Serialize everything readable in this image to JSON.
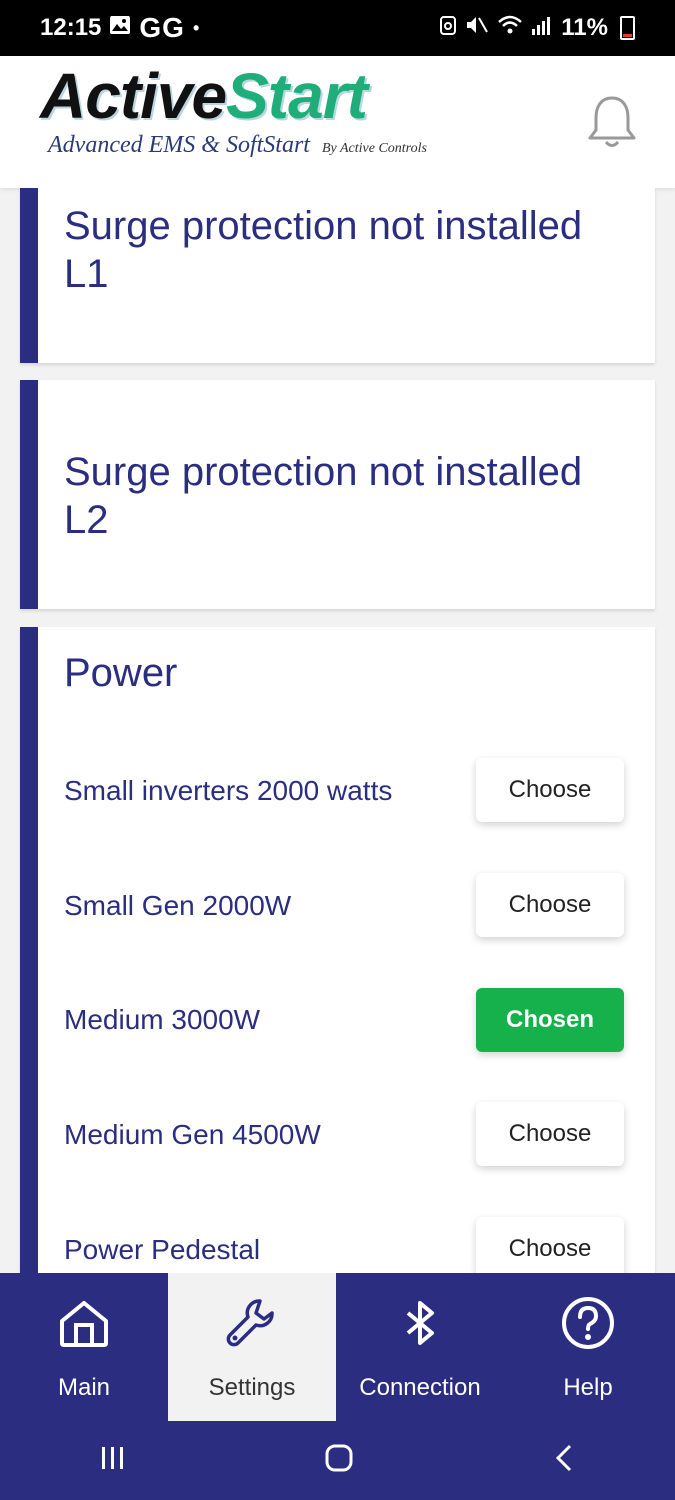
{
  "status_bar": {
    "time": "12:15",
    "carrier_badges": "GG",
    "dot": "•",
    "battery_percent": "11%"
  },
  "header": {
    "logo_active": "Active",
    "logo_start": "Start",
    "logo_subtitle": "Advanced EMS & SoftStart",
    "logo_by": "By Active Controls",
    "bell_icon": "bell-icon"
  },
  "cards": {
    "surge_l1": {
      "title_line1": "Surge protection not installed",
      "title_line2": "L1"
    },
    "surge_l2": {
      "title_line1": "Surge protection not installed",
      "title_line2": "L2"
    },
    "power": {
      "title": "Power",
      "options": [
        {
          "label": "Small inverters 2000 watts",
          "button": "Choose",
          "chosen": false
        },
        {
          "label": "Small Gen 2000W",
          "button": "Choose",
          "chosen": false
        },
        {
          "label": "Medium 3000W",
          "button": "Chosen",
          "chosen": true
        },
        {
          "label": "Medium Gen 4500W",
          "button": "Choose",
          "chosen": false
        },
        {
          "label": "Power Pedestal",
          "button": "Choose",
          "chosen": false
        }
      ]
    }
  },
  "bottom_nav": {
    "items": [
      {
        "label": "Main",
        "icon": "home-icon",
        "active": false
      },
      {
        "label": "Settings",
        "icon": "wrench-icon",
        "active": true
      },
      {
        "label": "Connection",
        "icon": "bluetooth-icon",
        "active": false
      },
      {
        "label": "Help",
        "icon": "help-icon",
        "active": false
      }
    ]
  },
  "colors": {
    "accent": "#2b2e80",
    "chosen": "#16b14a",
    "logo_green": "#1fae7a"
  }
}
